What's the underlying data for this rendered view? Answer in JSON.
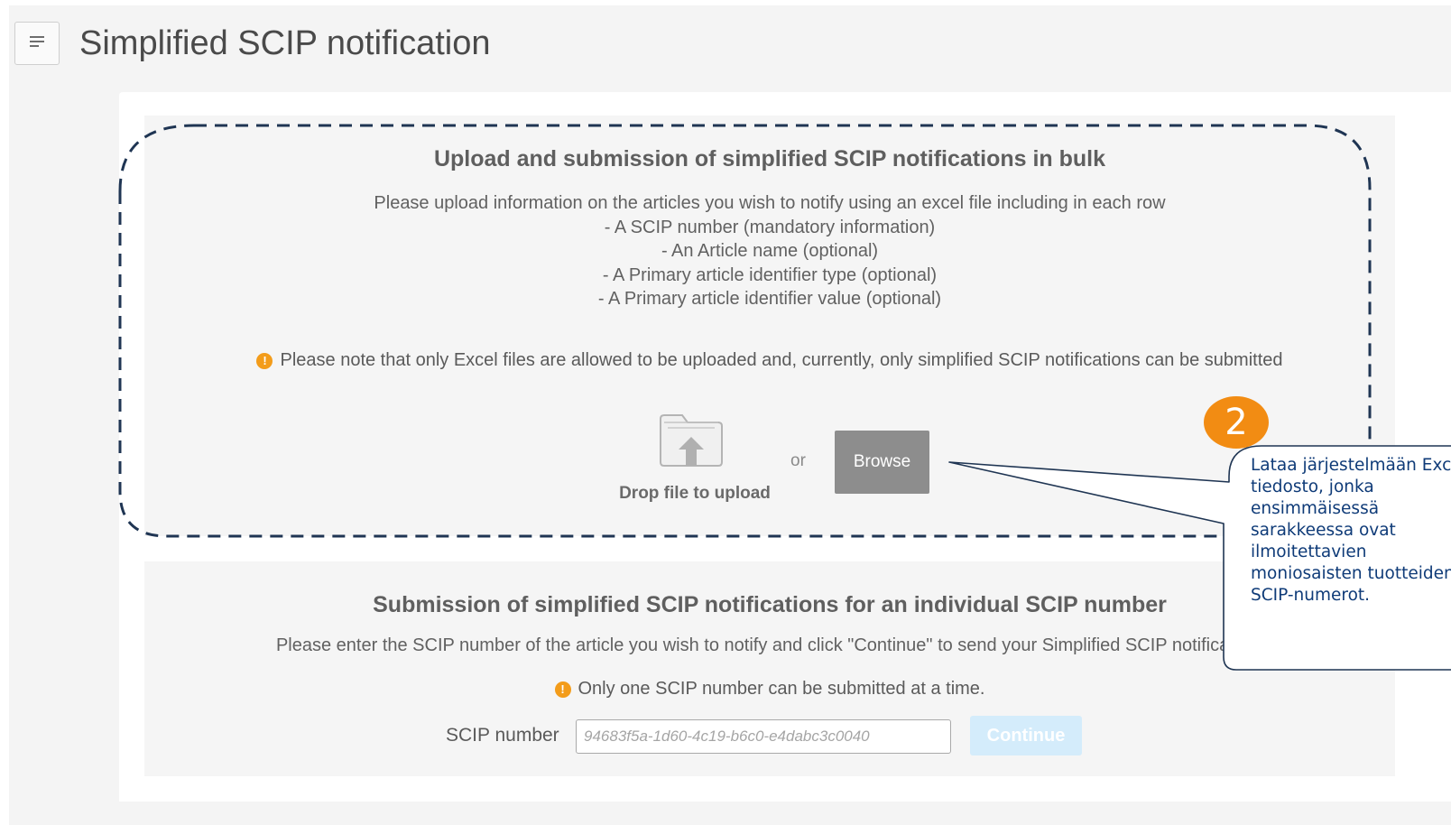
{
  "header": {
    "title": "Simplified SCIP notification",
    "menu_icon": "menu-icon"
  },
  "bulk": {
    "heading": "Upload and submission of simplified SCIP notifications in bulk",
    "lines": [
      "Please upload information on the articles you wish to notify using an excel file including in each row",
      "- A SCIP number (mandatory information)",
      "- An Article name (optional)",
      "- A Primary article identifier type (optional)",
      "- A Primary article identifier value (optional)"
    ],
    "note": "Please note that only Excel files are allowed to be uploaded and, currently, only simplified SCIP notifications can be submitted",
    "drop_label": "Drop file to upload",
    "or_label": "or",
    "browse_label": "Browse"
  },
  "individual": {
    "heading": "Submission of simplified SCIP notifications for an individual SCIP number",
    "description": "Please enter the SCIP number of the article you wish to notify and click \"Continue\" to send your Simplified SCIP notification.",
    "note": "Only one SCIP number can be submitted at a time.",
    "scip_label": "SCIP number",
    "scip_placeholder": "94683f5a-1d60-4c19-b6c0-e4dabc3c0040",
    "continue_label": "Continue"
  },
  "callout": {
    "badge": "2",
    "lines": [
      "Lataa järjestelmään Excel-",
      "tiedosto, jonka",
      "ensimmäisessä",
      "sarakkeessa ovat",
      "ilmoitettavien",
      "moniosaisten tuotteiden",
      "SCIP-numerot."
    ]
  },
  "colors": {
    "accent_orange": "#f28c13",
    "warning_orange": "#f39c1a",
    "dash_navy": "#1f3553",
    "callout_text": "#0f3b78"
  }
}
